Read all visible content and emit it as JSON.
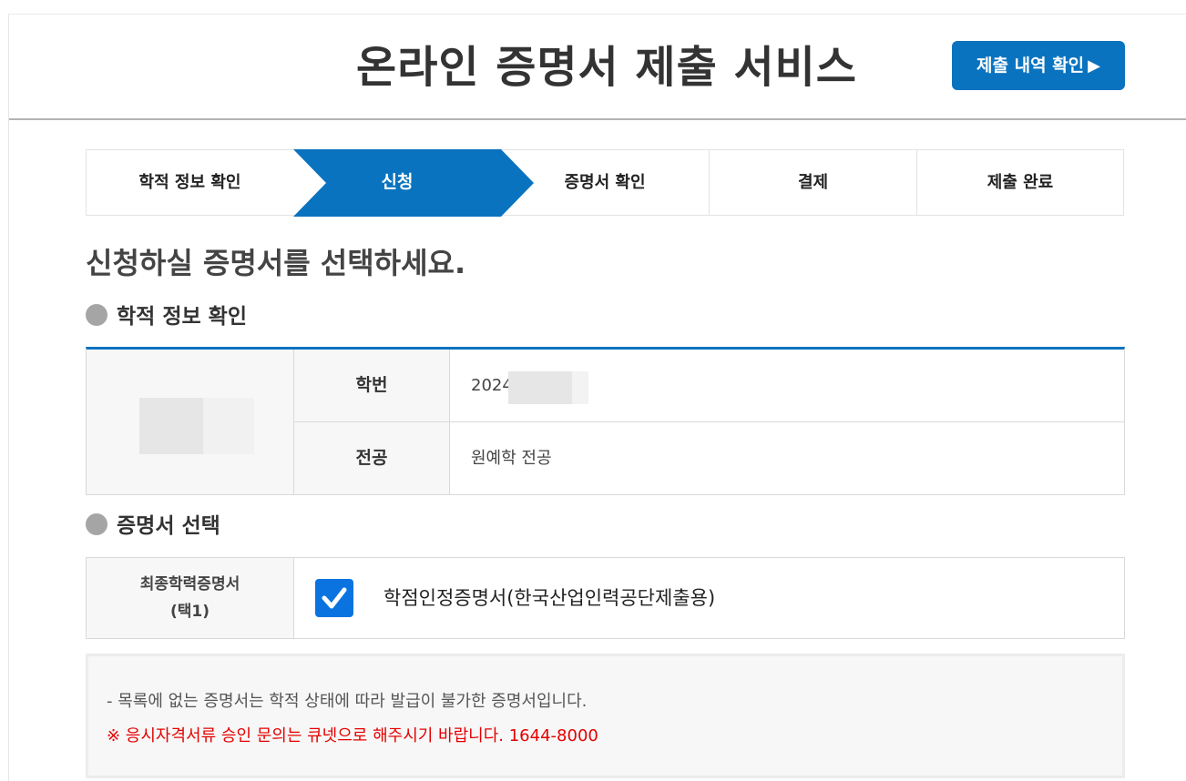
{
  "header": {
    "title": "온라인 증명서 제출 서비스",
    "history_button_label": "제출 내역 확인",
    "history_button_arrow": "▶"
  },
  "steps": [
    {
      "label": "학적 정보 확인",
      "active": false
    },
    {
      "label": "신청",
      "active": true
    },
    {
      "label": "증명서 확인",
      "active": false
    },
    {
      "label": "결제",
      "active": false
    },
    {
      "label": "제출 완료",
      "active": false
    }
  ],
  "main": {
    "heading": "신청하실 증명서를 선택하세요.",
    "student_section_title": "학적 정보 확인",
    "student_info": {
      "id_label": "학번",
      "id_value": "2024",
      "major_label": "전공",
      "major_value": "원예학 전공"
    },
    "cert_section_title": "증명서 선택",
    "cert_select": {
      "category_label_line1": "최종학력증명서",
      "category_label_line2": "(택1)",
      "option_label": "학점인정증명서(한국산업인력공단제출용)",
      "checked": true
    },
    "notice": {
      "line1": "- 목록에 없는 증명서는 학적 상태에 따라 발급이 불가한 증명서입니다.",
      "line2": "※ 응시자격서류 승인 문의는 큐넷으로 해주시기 바랍니다. 1644-8000"
    }
  },
  "colors": {
    "primary": "#0a73c0",
    "checkbox": "#0a73e0",
    "warning_text": "#e60000"
  }
}
